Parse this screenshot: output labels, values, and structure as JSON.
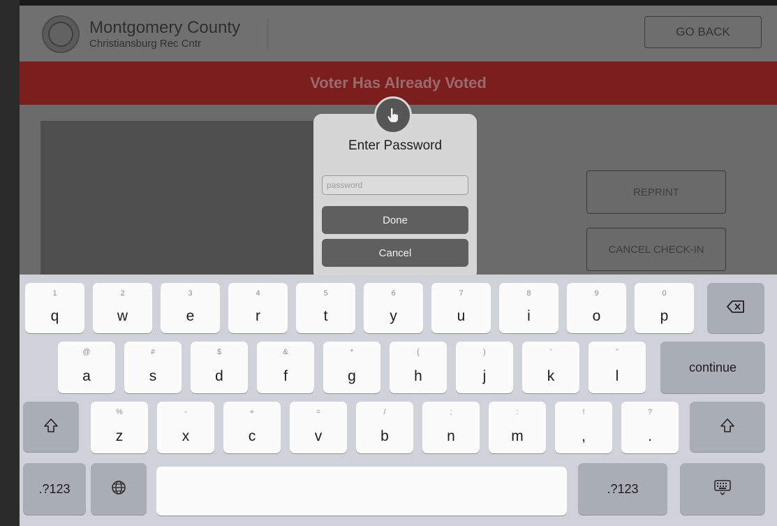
{
  "header": {
    "county": "Montgomery County",
    "location": "Christiansburg Rec Cntr",
    "go_back_label": "GO BACK"
  },
  "banner": {
    "text": "Voter Has Already Voted"
  },
  "actions": {
    "reprint_label": "REPRINT",
    "cancel_checkin_label": "CANCEL CHECK-IN"
  },
  "dialog": {
    "icon": "hand-pointer-icon",
    "title": "Enter Password",
    "password_placeholder": "password",
    "password_value": "",
    "done_label": "Done",
    "cancel_label": "Cancel"
  },
  "keyboard": {
    "row1": [
      {
        "main": "q",
        "alt": "1"
      },
      {
        "main": "w",
        "alt": "2"
      },
      {
        "main": "e",
        "alt": "3"
      },
      {
        "main": "r",
        "alt": "4"
      },
      {
        "main": "t",
        "alt": "5"
      },
      {
        "main": "y",
        "alt": "6"
      },
      {
        "main": "u",
        "alt": "7"
      },
      {
        "main": "i",
        "alt": "8"
      },
      {
        "main": "o",
        "alt": "9"
      },
      {
        "main": "p",
        "alt": "0"
      }
    ],
    "row2": [
      {
        "main": "a",
        "alt": "@"
      },
      {
        "main": "s",
        "alt": "#"
      },
      {
        "main": "d",
        "alt": "$"
      },
      {
        "main": "f",
        "alt": "&"
      },
      {
        "main": "g",
        "alt": "*"
      },
      {
        "main": "h",
        "alt": "("
      },
      {
        "main": "j",
        "alt": ")"
      },
      {
        "main": "k",
        "alt": "'"
      },
      {
        "main": "l",
        "alt": "\""
      }
    ],
    "row3": [
      {
        "main": "z",
        "alt": "%"
      },
      {
        "main": "x",
        "alt": "-"
      },
      {
        "main": "c",
        "alt": "+"
      },
      {
        "main": "v",
        "alt": "="
      },
      {
        "main": "b",
        "alt": "/"
      },
      {
        "main": "n",
        "alt": ";"
      },
      {
        "main": "m",
        "alt": ":"
      },
      {
        "main": ",",
        "alt": "!"
      },
      {
        "main": ".",
        "alt": "?"
      }
    ],
    "continue_label": "continue",
    "numbers_label": ".?123",
    "backspace_icon": "backspace-icon",
    "shift_icon": "shift-icon",
    "globe_icon": "globe-icon",
    "hide_keyboard_icon": "keyboard-hide-icon"
  }
}
